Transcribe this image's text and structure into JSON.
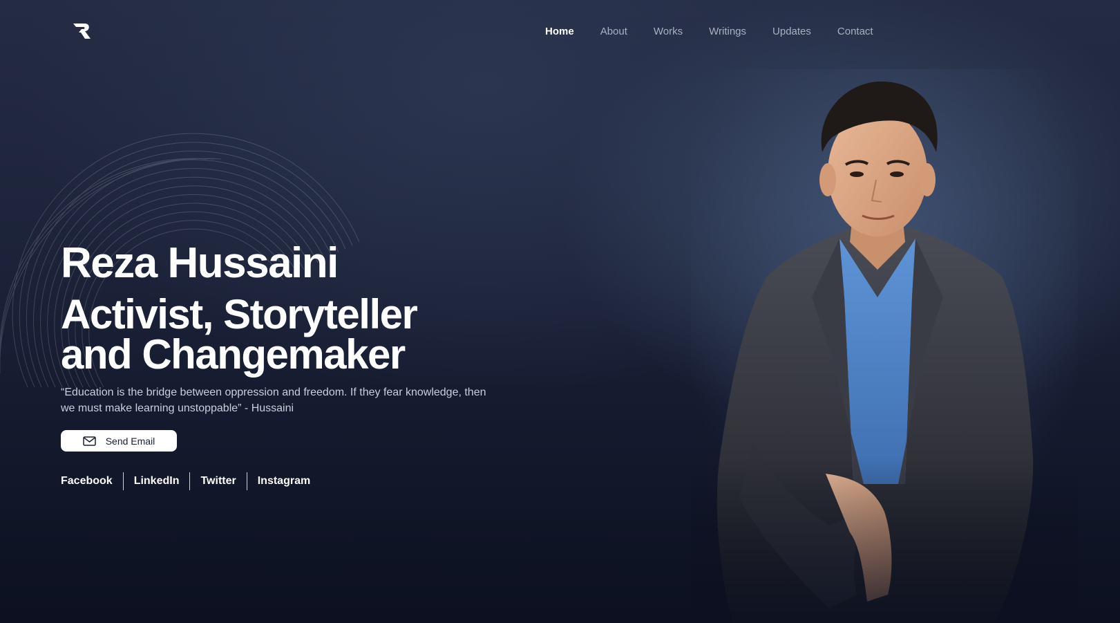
{
  "header": {
    "logo_alt": "R",
    "nav": [
      {
        "label": "Home",
        "active": true
      },
      {
        "label": "About",
        "active": false
      },
      {
        "label": "Works",
        "active": false
      },
      {
        "label": "Writings",
        "active": false
      },
      {
        "label": "Updates",
        "active": false
      },
      {
        "label": "Contact",
        "active": false
      }
    ]
  },
  "hero": {
    "name": "Reza Hussaini",
    "role_line1": "Activist, Storyteller",
    "role_line2": "and Changemaker",
    "quote": "“Education is the bridge between oppression and freedom. If they fear knowledge, then we must make learning unstoppable” - Hussaini",
    "email_button": {
      "label": "Send Email",
      "icon": "mail-icon"
    }
  },
  "social": [
    {
      "label": "Facebook"
    },
    {
      "label": "LinkedIn"
    },
    {
      "label": "Twitter"
    },
    {
      "label": "Instagram"
    }
  ],
  "colors": {
    "background_top": "#242c44",
    "background_bottom": "#0c1020",
    "nav_inactive": "#a9b0c0",
    "text": "#ffffff",
    "button_bg": "#ffffff"
  }
}
